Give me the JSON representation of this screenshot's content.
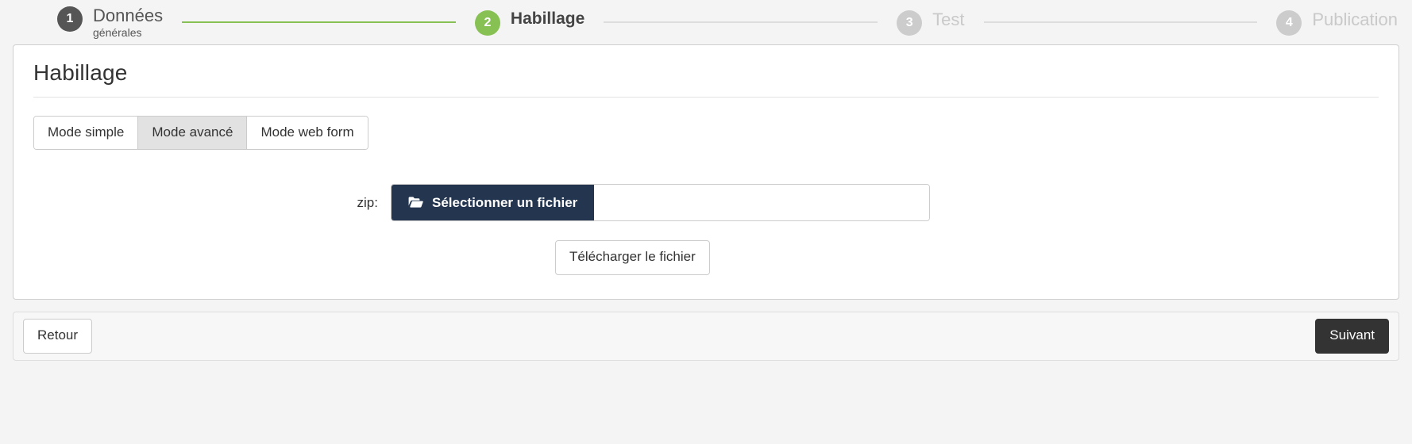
{
  "stepper": {
    "steps": [
      {
        "number": "1",
        "title": "Données",
        "subtitle": "générales",
        "state": "done"
      },
      {
        "number": "2",
        "title": "Habillage",
        "subtitle": "",
        "state": "active"
      },
      {
        "number": "3",
        "title": "Test",
        "subtitle": "",
        "state": "todo"
      },
      {
        "number": "4",
        "title": "Publication",
        "subtitle": "",
        "state": "todo"
      }
    ],
    "colors": {
      "done": "#555555",
      "active": "#88c153",
      "todo": "#cccccc",
      "connector_done": "#88c153",
      "connector_todo": "#dddddd"
    }
  },
  "card": {
    "title": "Habillage",
    "tabs": [
      {
        "label": "Mode simple",
        "selected": false
      },
      {
        "label": "Mode avancé",
        "selected": true
      },
      {
        "label": "Mode web form",
        "selected": false
      }
    ],
    "form": {
      "zip_label": "zip:",
      "browse_button": "Sélectionner un fichier",
      "browse_icon": "folder-open-icon",
      "file_value": "",
      "file_placeholder": "",
      "upload_button": "Télécharger le fichier"
    }
  },
  "footer": {
    "back_label": "Retour",
    "next_label": "Suivant",
    "next_color": "#333333"
  }
}
